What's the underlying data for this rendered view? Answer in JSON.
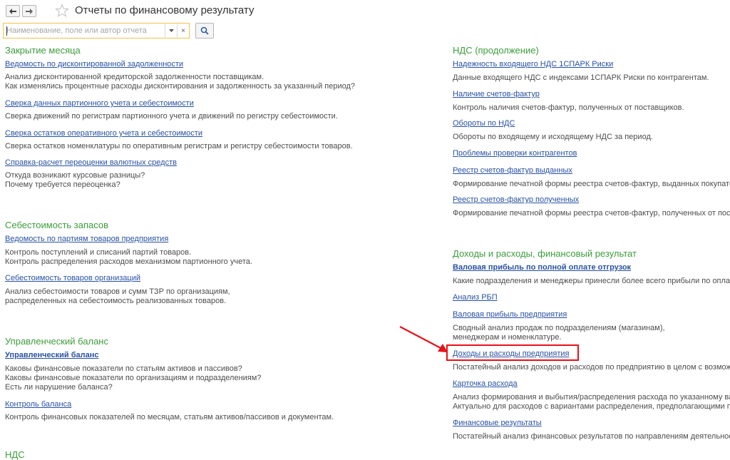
{
  "header": {
    "title": "Отчеты по финансовому результату",
    "back_icon": "arrow-left-icon",
    "forward_icon": "arrow-right-icon",
    "favorite_icon": "star-icon"
  },
  "search": {
    "value": "",
    "placeholder": "Наименование, поле или автор отчета",
    "dropdown_icon": "chevron-down-icon",
    "clear_label": "×",
    "find_icon": "search-icon"
  },
  "left_column": {
    "month_close": {
      "title": "Закрытие месяца",
      "items": [
        {
          "link": "Ведомость по дисконтированной задолженности",
          "desc": [
            "Анализ дисконтированной кредиторской задолженности поставщикам.",
            "Как изменялись процентные расходы дисконтирования и задолженность за указанный период?"
          ]
        },
        {
          "link": "Сверка данных партионного учета и себестоимости",
          "desc": [
            "Сверка движений по регистрам партионного учета и движений по регистру себестоимости."
          ]
        },
        {
          "link": "Сверка остатков оперативного учета и себестоимости",
          "desc": [
            "Сверка остатков номенклатуры по оперативным регистрам и регистру себестоимости товаров."
          ]
        },
        {
          "link": "Справка-расчет переоценки валютных средств",
          "desc": [
            "Откуда возникают курсовые разницы?",
            "Почему требуется переоценка?"
          ]
        }
      ]
    },
    "inventory_cost": {
      "title": "Себестоимость запасов",
      "items": [
        {
          "link": "Ведомость по партиям товаров предприятия",
          "desc": [
            "Контроль поступлений и списаний партий товаров.",
            "Контроль распределения расходов механизмом партионного учета."
          ]
        },
        {
          "link": "Себестоимость товаров организаций",
          "desc": [
            "Анализ себестоимости товаров и сумм ТЗР по организациям,",
            "распределенных на себестоимость реализованных товаров."
          ]
        }
      ]
    },
    "mgmt_balance": {
      "title": "Управленческий баланс",
      "items": [
        {
          "link": "Управленческий баланс",
          "desc": [
            "Каковы финансовые показатели по статьям активов и пассивов?",
            "Каковы финансовые показатели по организациям и подразделениям?",
            "Есть ли нарушение баланса?"
          ]
        },
        {
          "link": "Контроль баланса",
          "desc": [
            "Контроль финансовых показателей по месяцам, статьям активов/пассивов и документам."
          ]
        }
      ]
    },
    "vat_title_cut": "НДС"
  },
  "right_column": {
    "vat_cont": {
      "title": "НДС (продолжение)",
      "items": [
        {
          "link": "Надежность входящего НДС 1СПАРК Риски",
          "desc": [
            "Данные входящего НДС с индексами 1СПАРК Риски по контрагентам."
          ]
        },
        {
          "link": "Наличие счетов-фактур",
          "desc": [
            "Контроль наличия счетов-фактур, полученных от поставщиков."
          ]
        },
        {
          "link": "Обороты по НДС",
          "desc": [
            "Обороты по входящему и исходящему НДС за период."
          ]
        },
        {
          "link": "Проблемы проверки контрагентов",
          "desc": []
        },
        {
          "link": "Реестр счетов-фактур выданных",
          "desc": [
            "Формирование печатной формы реестра счетов-фактур, выданных покупателям"
          ]
        },
        {
          "link": "Реестр счетов-фактур полученных",
          "desc": [
            "Формирование печатной формы реестра счетов-фактур, полученных от поставщиков"
          ]
        }
      ]
    },
    "income": {
      "title": "Доходы и расходы, финансовый результат",
      "items": [
        {
          "link": "Валовая прибыль по полной оплате отгрузок",
          "desc": [
            "Какие подразделения и менеджеры принесли более всего прибыли по оплате"
          ]
        },
        {
          "link": "Анализ РБП",
          "desc": []
        },
        {
          "link": "Валовая прибыль предприятия",
          "desc": [
            "Сводный анализ продаж по подразделениям (магазинам),",
            "менеджерам и номенклатуре."
          ]
        },
        {
          "link": "Доходы и расходы предприятия",
          "desc": [
            "Постатейный анализ доходов и расходов по предприятию в целом с возможностью"
          ]
        },
        {
          "link": "Карточка расхода",
          "desc": [
            "Анализ формирования и выбытия/распределения расхода по указанному варианту",
            "Актуально для расходов с вариантами распределения, предполагающими пе"
          ]
        },
        {
          "link": "Финансовые результаты",
          "desc": [
            "Постатейный анализ финансовых результатов по направлениям деятельности"
          ]
        }
      ]
    }
  },
  "annotation": {
    "color": "#e8101a"
  }
}
